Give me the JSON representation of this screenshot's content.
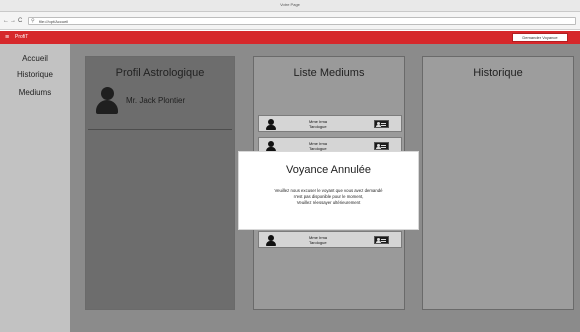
{
  "browser": {
    "title": "Votre Page",
    "url": "file:///opt/Accueil",
    "nav_back": "←",
    "nav_forward": "→",
    "nav_reload": "C"
  },
  "app": {
    "brand": "ProfiT",
    "action_button": "Demander Voyance",
    "accent_color": "#d6282b"
  },
  "sidebar": {
    "items": [
      {
        "label": "Accueil"
      },
      {
        "label": "Historique"
      },
      {
        "label": "Mediums"
      }
    ]
  },
  "profil": {
    "title": "Profil Astrologique",
    "user_name": "Mr. Jack Plontier"
  },
  "mediums": {
    "title": "Liste Mediums",
    "items": [
      {
        "name": "Mme Irma",
        "type": "Tarologue"
      },
      {
        "name": "Mme Irma",
        "type": "Tarologue"
      },
      {
        "name": "Mme Irma",
        "type": "Tarologue"
      }
    ]
  },
  "historique": {
    "title": "Historique"
  },
  "modal": {
    "title": "Voyance Annulée",
    "lines": [
      "Veuillez nous excuser le voyant que vous avez demandé",
      "n'est pas disponible pour le moment,",
      "Veuillez réessayer ultérieurement"
    ]
  }
}
